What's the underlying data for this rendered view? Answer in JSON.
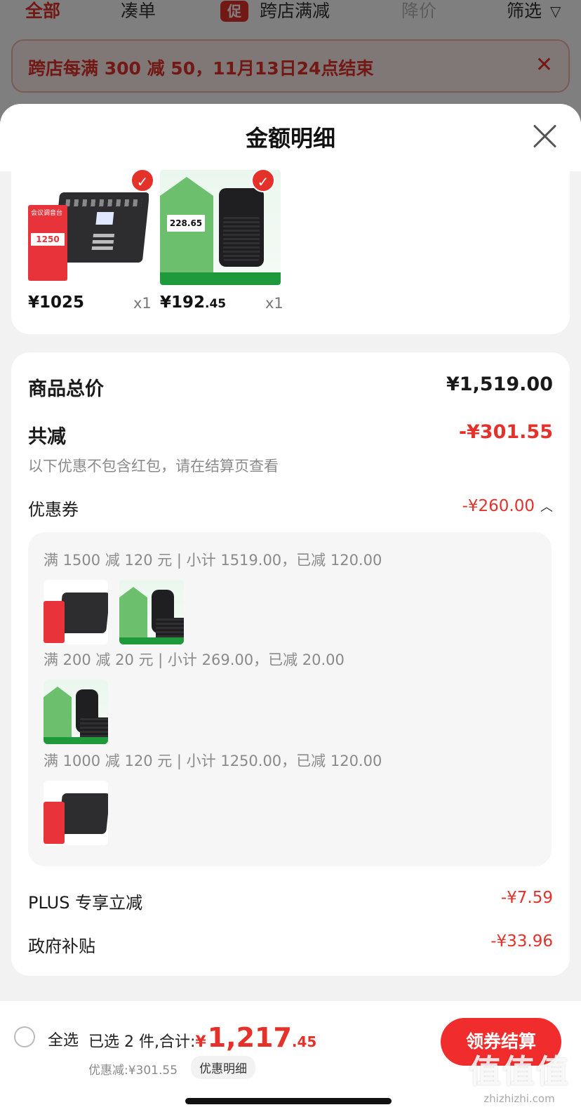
{
  "filter_bar": {
    "all": "全部",
    "bundle": "凑单",
    "cross_badge": "促",
    "cross_store": "跨店满减",
    "price_drop": "降价",
    "filter": "筛选"
  },
  "promo_banner": {
    "text": "跨店每满 300 减 50，11月13日24点结束"
  },
  "sheet": {
    "title": "金额明细"
  },
  "products": [
    {
      "price": "¥1025",
      "price_decimal": "",
      "qty": "x1",
      "image": "mixer",
      "thumb_text": "会议调音台",
      "thumb_price": "1250"
    },
    {
      "price": "¥192",
      "price_decimal": ".45",
      "qty": "x1",
      "image": "speaker",
      "thumb_text": "228.65"
    }
  ],
  "detail": {
    "total_label": "商品总价",
    "total_value": "¥1,519.00",
    "reduce_label": "共减",
    "reduce_value": "-¥301.55",
    "reduce_note": "以下优惠不包含红包，请在结算页查看",
    "coupon_label": "优惠券",
    "coupon_value": "-¥260.00",
    "coupon_rules": [
      {
        "text": "满 1500 减 120 元 | 小计 1519.00，已减 120.00",
        "items": [
          "mixer",
          "speaker"
        ]
      },
      {
        "text": "满 200 减 20 元 | 小计 269.00，已减 20.00",
        "items": [
          "speaker"
        ]
      },
      {
        "text": "满 1000 减 120 元 | 小计 1250.00，已减 120.00",
        "items": [
          "mixer"
        ]
      }
    ],
    "plus_label": "PLUS 专享立减",
    "plus_value": "-¥7.59",
    "gov_label": "政府补贴",
    "gov_value": "-¥33.96"
  },
  "bottom_bar": {
    "select_all": "全选",
    "selected_text": "已选 2 件,合计:",
    "currency": "¥",
    "sum_int": "1,217",
    "sum_dec": ".45",
    "saved_text": "优惠减:¥301.55",
    "detail_link": "优惠明细",
    "checkout": "领券结算"
  },
  "watermark": {
    "big": "值值值",
    "small": "zhizhizhi.com"
  },
  "colors": {
    "accent": "#e4322a",
    "checkout": "#f12c2c"
  }
}
